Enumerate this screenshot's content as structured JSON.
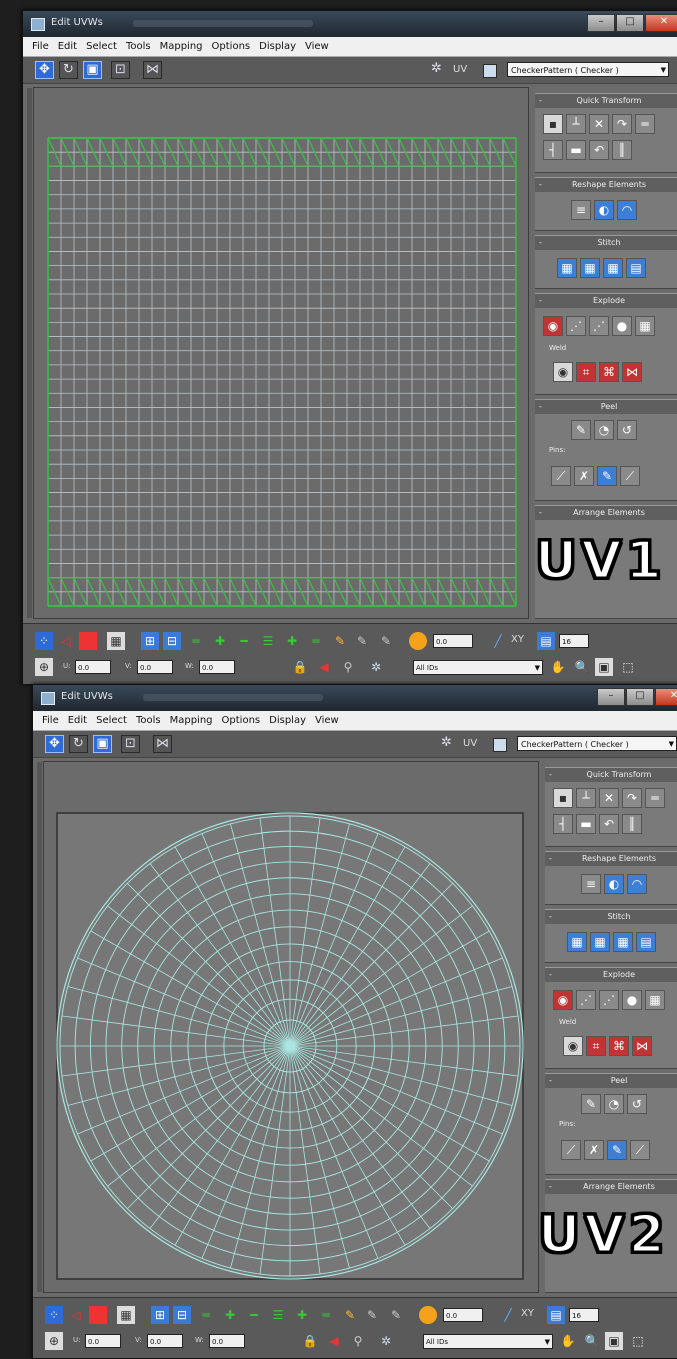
{
  "windows": [
    {
      "title": "Edit UVWs",
      "menu": [
        "File",
        "Edit",
        "Select",
        "Tools",
        "Mapping",
        "Options",
        "Display",
        "View"
      ],
      "uv_label": "UV",
      "texture_dropdown": "CheckerPattern  ( Checker )",
      "rollouts": [
        {
          "title": "Quick Transform"
        },
        {
          "title": "Reshape Elements"
        },
        {
          "title": "Stitch"
        },
        {
          "title": "Explode",
          "sub": "Weld"
        },
        {
          "title": "Peel",
          "sub": "Pins:"
        },
        {
          "title": "Arrange Elements"
        }
      ],
      "overlay_tag": "UV1",
      "mesh_type": "planar grid",
      "bottom": {
        "uv_readout": "XY",
        "u_label": "U:",
        "v_label": "V:",
        "w_label": "W:",
        "u_value": "0.0",
        "v_value": "0.0",
        "w_value": "0.0",
        "spinner_value": "0.0",
        "filter_dropdown": "All IDs",
        "zoom_value": "16"
      }
    },
    {
      "title": "Edit UVWs",
      "menu": [
        "File",
        "Edit",
        "Select",
        "Tools",
        "Mapping",
        "Options",
        "Display",
        "View"
      ],
      "uv_label": "UV",
      "texture_dropdown": "CheckerPattern  ( Checker )",
      "rollouts": [
        {
          "title": "Quick Transform"
        },
        {
          "title": "Reshape Elements"
        },
        {
          "title": "Stitch"
        },
        {
          "title": "Explode",
          "sub": "Weld"
        },
        {
          "title": "Peel",
          "sub": "Pins:"
        },
        {
          "title": "Arrange Elements"
        }
      ],
      "overlay_tag": "UV2",
      "mesh_type": "radial disc",
      "bottom": {
        "uv_readout": "XY",
        "u_label": "U:",
        "v_label": "V:",
        "w_label": "W:",
        "u_value": "0.0",
        "v_value": "0.0",
        "w_value": "0.0",
        "spinner_value": "0.0",
        "filter_dropdown": "All IDs",
        "zoom_value": "16"
      }
    }
  ],
  "colors": {
    "grid_line": "#b9c3c8",
    "grid_seam": "#3fb84a",
    "disc_line": "#a9e6e2",
    "selection_blue": "#2f6bd8"
  }
}
